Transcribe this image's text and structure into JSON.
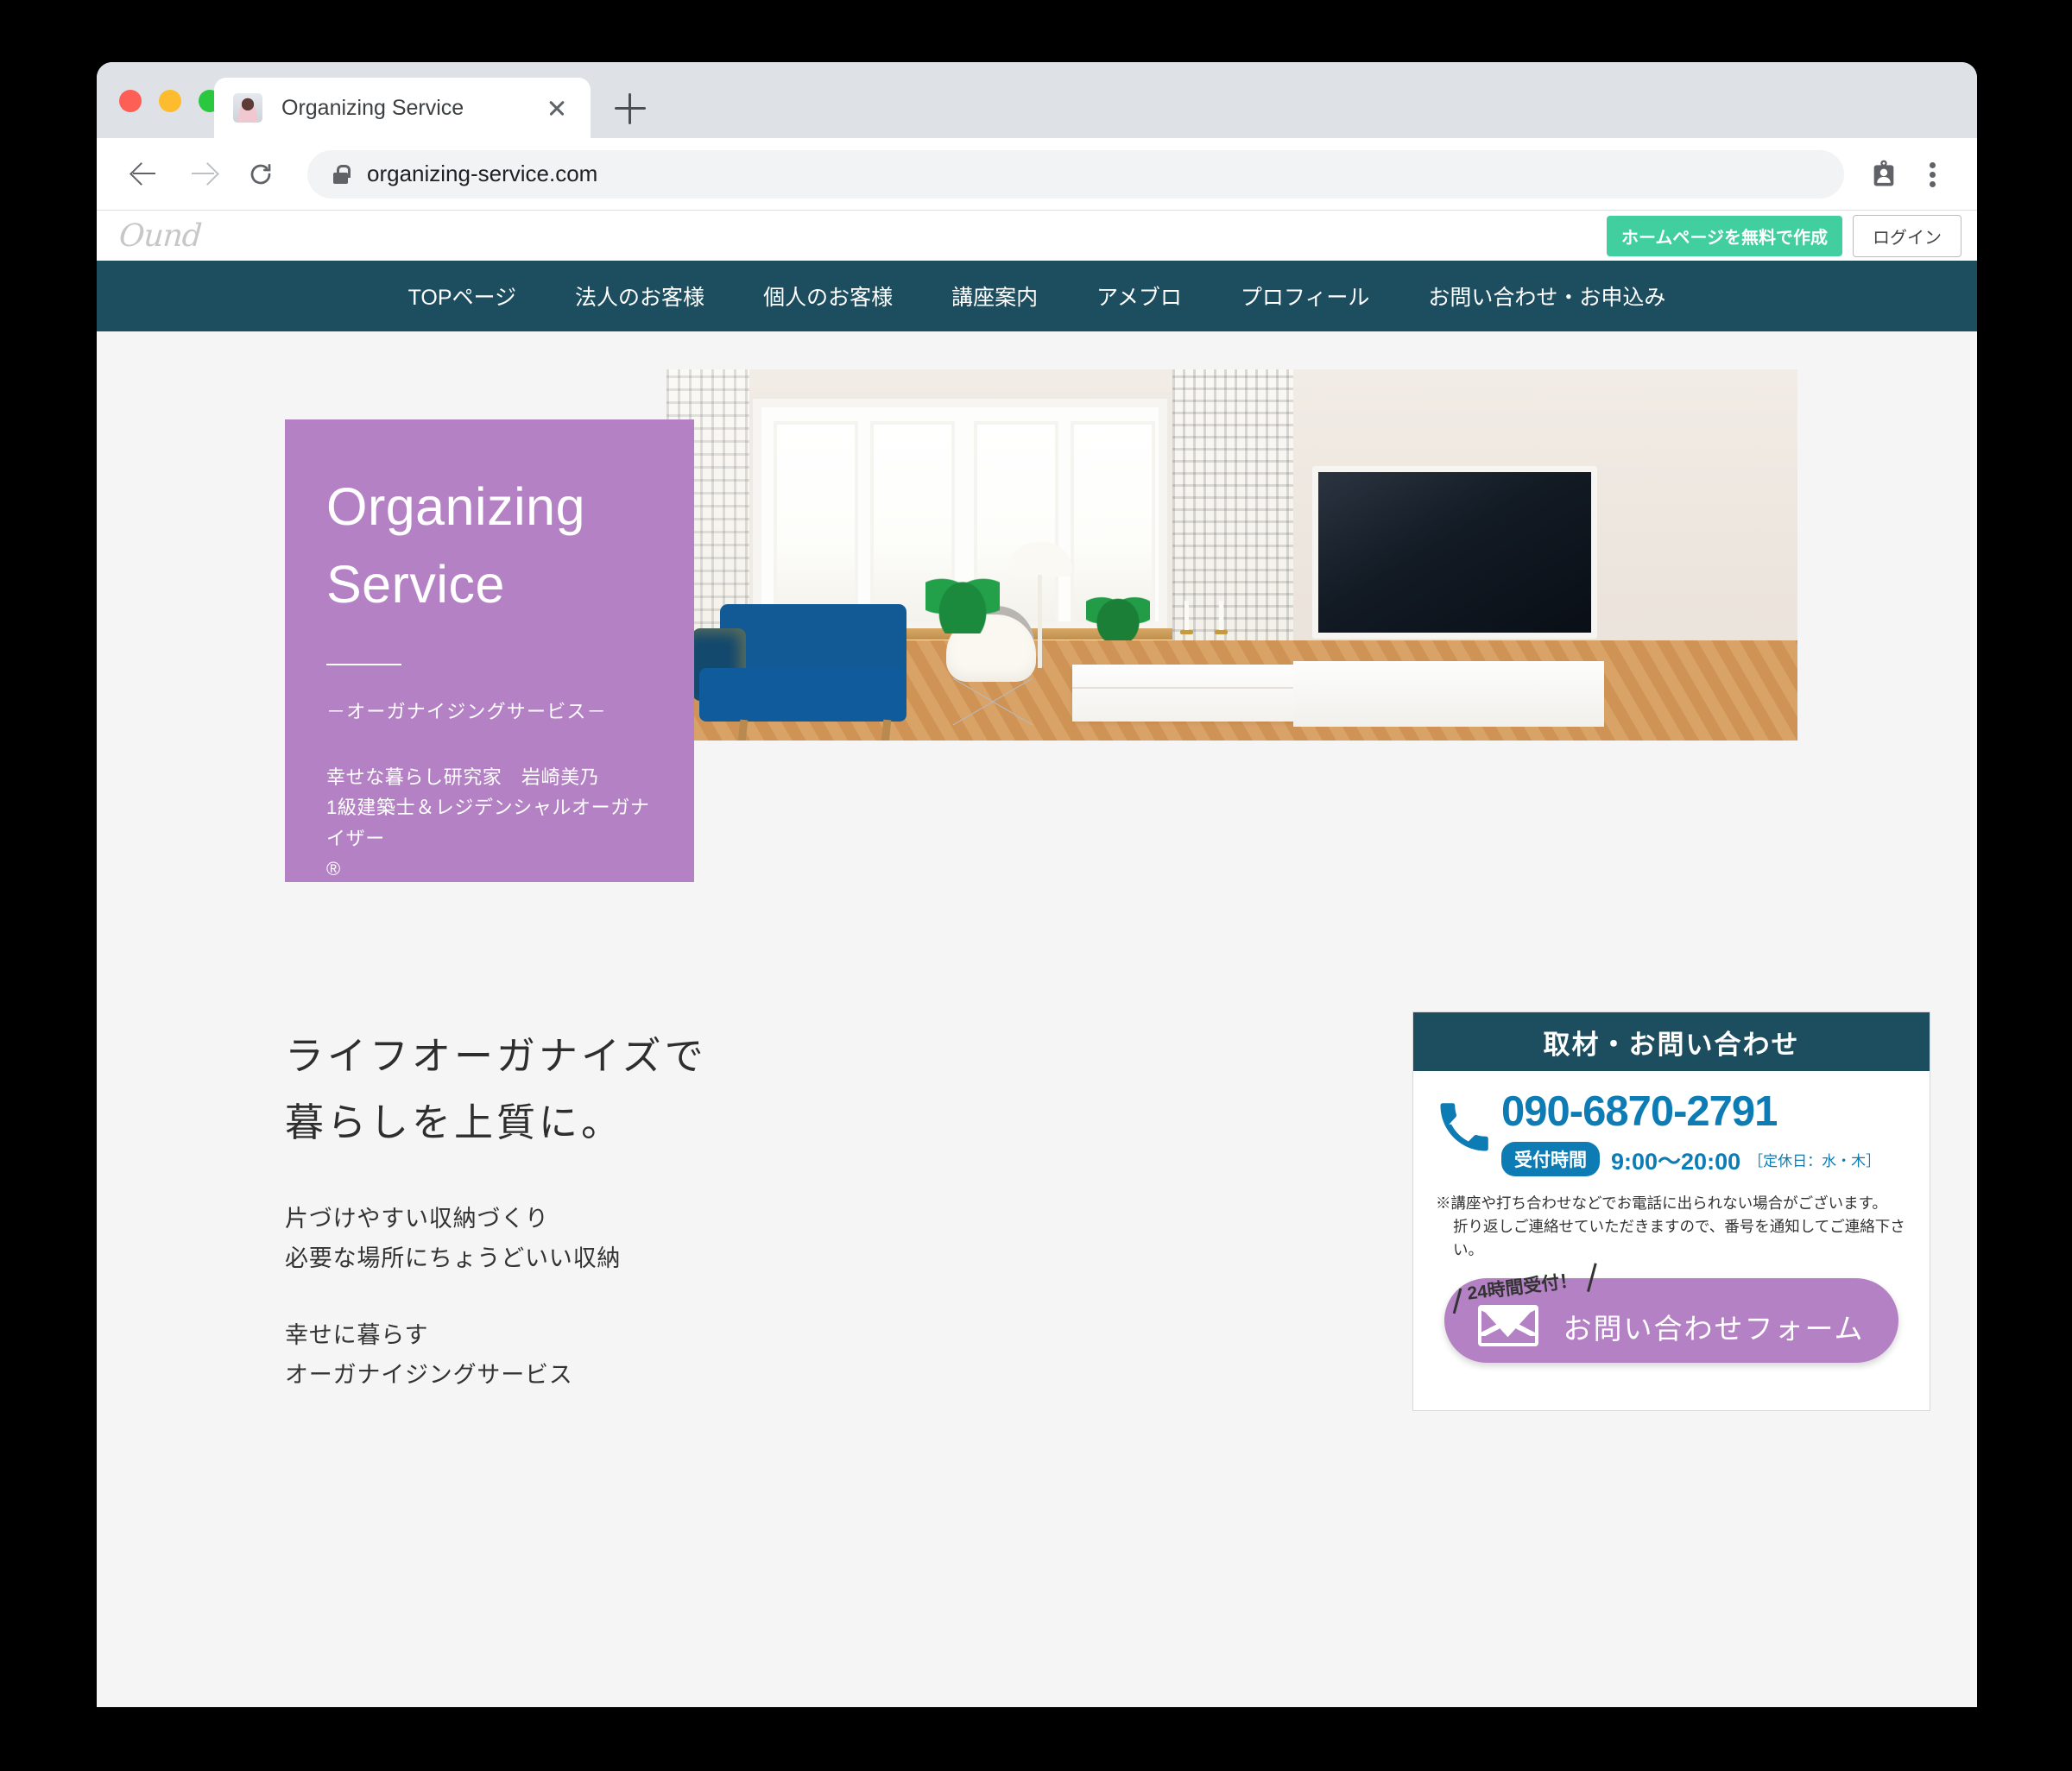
{
  "browser": {
    "tab_title": "Organizing Service",
    "url": "organizing-service.com",
    "icons": {
      "back": "back-arrow-icon",
      "forward": "forward-arrow-icon",
      "reload": "reload-icon",
      "lock": "lock-icon",
      "profile": "profile-card-icon",
      "menu": "three-dot-menu-icon",
      "close_tab": "close-icon",
      "new_tab": "plus-icon",
      "favicon": "site-favicon-portrait"
    }
  },
  "ound_bar": {
    "logo": "Ound",
    "create_button": "ホームページを無料で作成",
    "login_button": "ログイン",
    "accent_green": "#41cfa0"
  },
  "nav": {
    "items": [
      {
        "label": "TOPページ"
      },
      {
        "label": "法人のお客様"
      },
      {
        "label": "個人のお客様"
      },
      {
        "label": "講座案内"
      },
      {
        "label": "アメブロ"
      },
      {
        "label": "プロフィール"
      },
      {
        "label": "お問い合わせ・お申込み"
      }
    ],
    "background": "#1d4e5f"
  },
  "hero": {
    "title_line1": "Organizing",
    "title_line2": "Service",
    "subtitle": "－オーガナイジングサービス－",
    "desc_line1": "幸せな暮らし研究家　岩崎美乃",
    "desc_line2": "1級建築士＆レジデンシャルオーガナイザー",
    "desc_line3": "®",
    "card_color": "#b482c4",
    "photo_alt": "living-room-interior-photo"
  },
  "main": {
    "lead_line1": "ライフオーガナイズで",
    "lead_line2": "暮らしを上質に。",
    "body_line1": "片づけやすい収納づくり",
    "body_line2": "必要な場所にちょうどいい収納",
    "body_line3": "幸せに暮らす",
    "body_line4": "オーガナイジングサービス"
  },
  "contact": {
    "header": "取材・お問い合わせ",
    "phone": "090-6870-2791",
    "hours_label": "受付時間",
    "hours_time": "9:00〜20:00",
    "closed_days": "［定休日：水・木］",
    "notice_line1": "※講座や打ち合わせなどでお電話に出られない場合がございます。",
    "notice_line2": "折り返しご連絡せていただきますので、番号を通知してご連絡下さい。",
    "badge": "24時間受付！",
    "form_button": "お問い合わせフォーム",
    "phone_color": "#0d7cb5",
    "header_color": "#1d4e5f",
    "button_color": "#b482c4"
  }
}
